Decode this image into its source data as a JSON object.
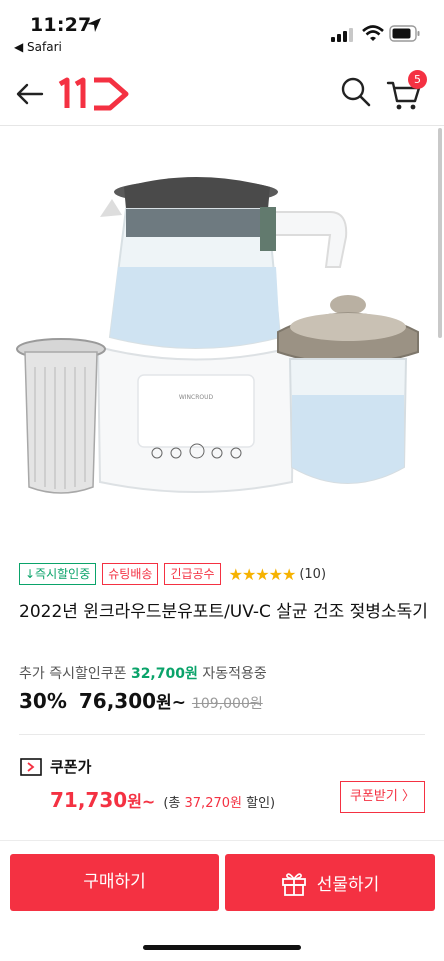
{
  "status": {
    "time": "11:27",
    "back_app": "◀ Safari"
  },
  "header": {
    "logo_text": "11",
    "cart_count": "5"
  },
  "product": {
    "badges": [
      {
        "label": "↓즉시할인중",
        "color": "#0aa36a"
      },
      {
        "label": "슈팅배송",
        "color": "#f43142"
      },
      {
        "label": "긴급공수",
        "color": "#f43142"
      }
    ],
    "rating_stars": "★★★★★",
    "rating": 5,
    "review_count": "(10)",
    "title": "2022년 윈크라우드분유포트/UV-C 살균 건조 젖병소독기",
    "coupon_prefix": "추가 즉시할인쿠폰",
    "coupon_amount": "32,700원",
    "coupon_suffix": "자동적용중",
    "discount_rate": "30%",
    "price": "76,300",
    "price_unit": "원~",
    "original_price": "109,000원",
    "image_brand_text": "WINCROUD"
  },
  "coupon": {
    "label": "쿠폰가",
    "price": "71,730",
    "price_unit": "원~",
    "note_prefix": "(총",
    "note_amount": "37,270원",
    "note_suffix": "할인)",
    "button_label": "쿠폰받기 〉"
  },
  "actions": {
    "buy_label": "구매하기",
    "gift_label": "선물하기"
  },
  "colors": {
    "accent": "#f43142",
    "green": "#0aa36a",
    "star": "#f6b200"
  }
}
